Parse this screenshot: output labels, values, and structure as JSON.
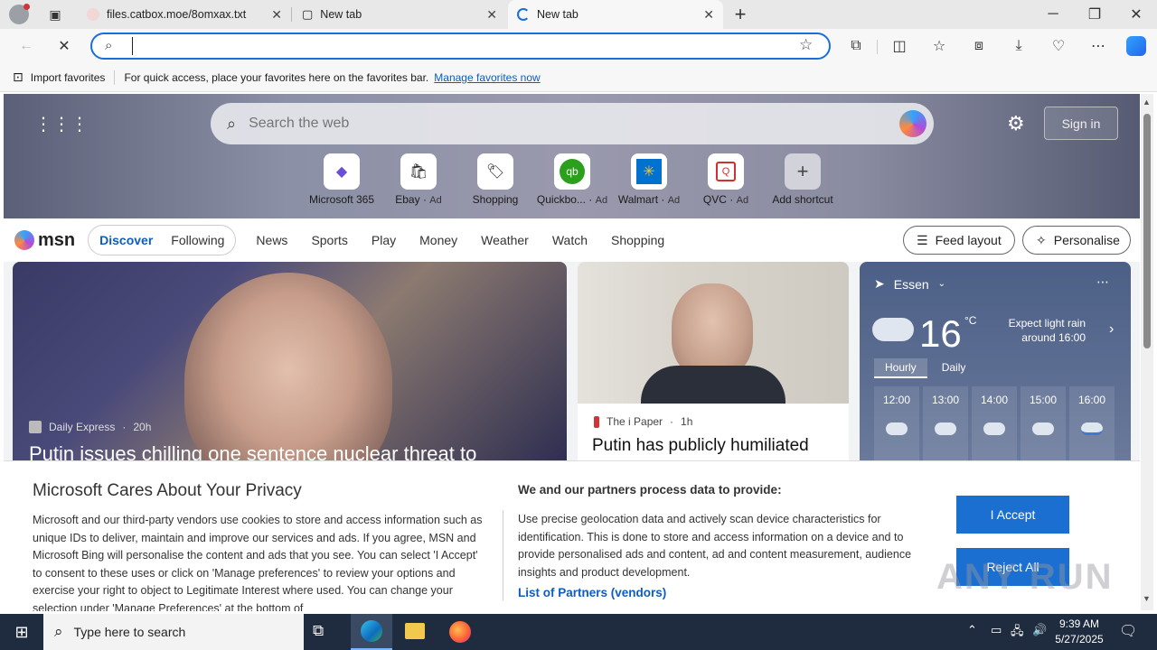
{
  "tabs": [
    {
      "title": "files.catbox.moe/8omxax.txt"
    },
    {
      "title": "New tab"
    },
    {
      "title": "New tab"
    }
  ],
  "new_tab_icon": "+",
  "window_controls": {
    "minimize": "─",
    "restore": "❐",
    "close": "✕"
  },
  "address_bar": {
    "value": "",
    "placeholder": ""
  },
  "favorites_bar": {
    "import_label": "Import favorites",
    "message": "For quick access, place your favorites here on the favorites bar.",
    "manage_link": "Manage favorites now"
  },
  "hero": {
    "search_placeholder": "Search the web",
    "sign_in": "Sign in",
    "shortcuts": [
      {
        "label": "Microsoft 365",
        "ad": "",
        "icon": "m365-icon",
        "color": "#6b4ed8"
      },
      {
        "label": "Ebay",
        "ad": "Ad",
        "icon": "ebay-icon",
        "color": "#333333"
      },
      {
        "label": "Shopping",
        "ad": "",
        "icon": "tag-icon",
        "color": "#555555"
      },
      {
        "label": "Quickbo...",
        "ad": "Ad",
        "icon": "quickbooks-icon",
        "color": "#2ca01c"
      },
      {
        "label": "Walmart",
        "ad": "Ad",
        "icon": "walmart-icon",
        "color": "#0071ce"
      },
      {
        "label": "QVC",
        "ad": "Ad",
        "icon": "qvc-icon",
        "color": "#d0312d"
      },
      {
        "label": "Add shortcut",
        "ad": "",
        "icon": "plus-icon",
        "color": "#555555"
      }
    ]
  },
  "msn": {
    "logo": "msn",
    "discover": "Discover",
    "following": "Following",
    "nav": [
      "News",
      "Sports",
      "Play",
      "Money",
      "Weather",
      "Watch",
      "Shopping"
    ],
    "feed_layout": "Feed layout",
    "personalise": "Personalise"
  },
  "cards": {
    "main": {
      "source": "Daily Express",
      "age": "20h",
      "headline": "Putin issues chilling one sentence nuclear threat to"
    },
    "second": {
      "source": "The i Paper",
      "age": "1h",
      "headline": "Putin has publicly humiliated"
    }
  },
  "weather": {
    "location": "Essen",
    "temp": "16",
    "unit": "°C",
    "summary_line1": "Expect light rain",
    "summary_line2": "around 16:00",
    "tabs": [
      "Hourly",
      "Daily"
    ],
    "hours": [
      "12:00",
      "13:00",
      "14:00",
      "15:00",
      "16:00"
    ]
  },
  "consent": {
    "title": "Microsoft Cares About Your Privacy",
    "body": "Microsoft and our third-party vendors use cookies to store and access information such as unique IDs to deliver, maintain and improve our services and ads. If you agree, MSN and Microsoft Bing will personalise the content and ads that you see. You can select 'I Accept' to consent to these uses or click on 'Manage preferences' to review your options and exercise your right to object to Legitimate Interest where used. You can change your selection under 'Manage Preferences' at the bottom of",
    "partners_title": "We and our partners process data to provide:",
    "partners_body": "Use precise geolocation data and actively scan device characteristics for identification. This is done to store and access information on a device and to provide personalised ads and content, ad and content measurement, audience insights and product development.",
    "partners_link": "List of Partners (vendors)",
    "accept": "I Accept",
    "reject": "Reject All"
  },
  "watermark": "ANY RUN",
  "taskbar": {
    "search_placeholder": "Type here to search",
    "time": "9:39 AM",
    "date": "5/27/2025"
  }
}
